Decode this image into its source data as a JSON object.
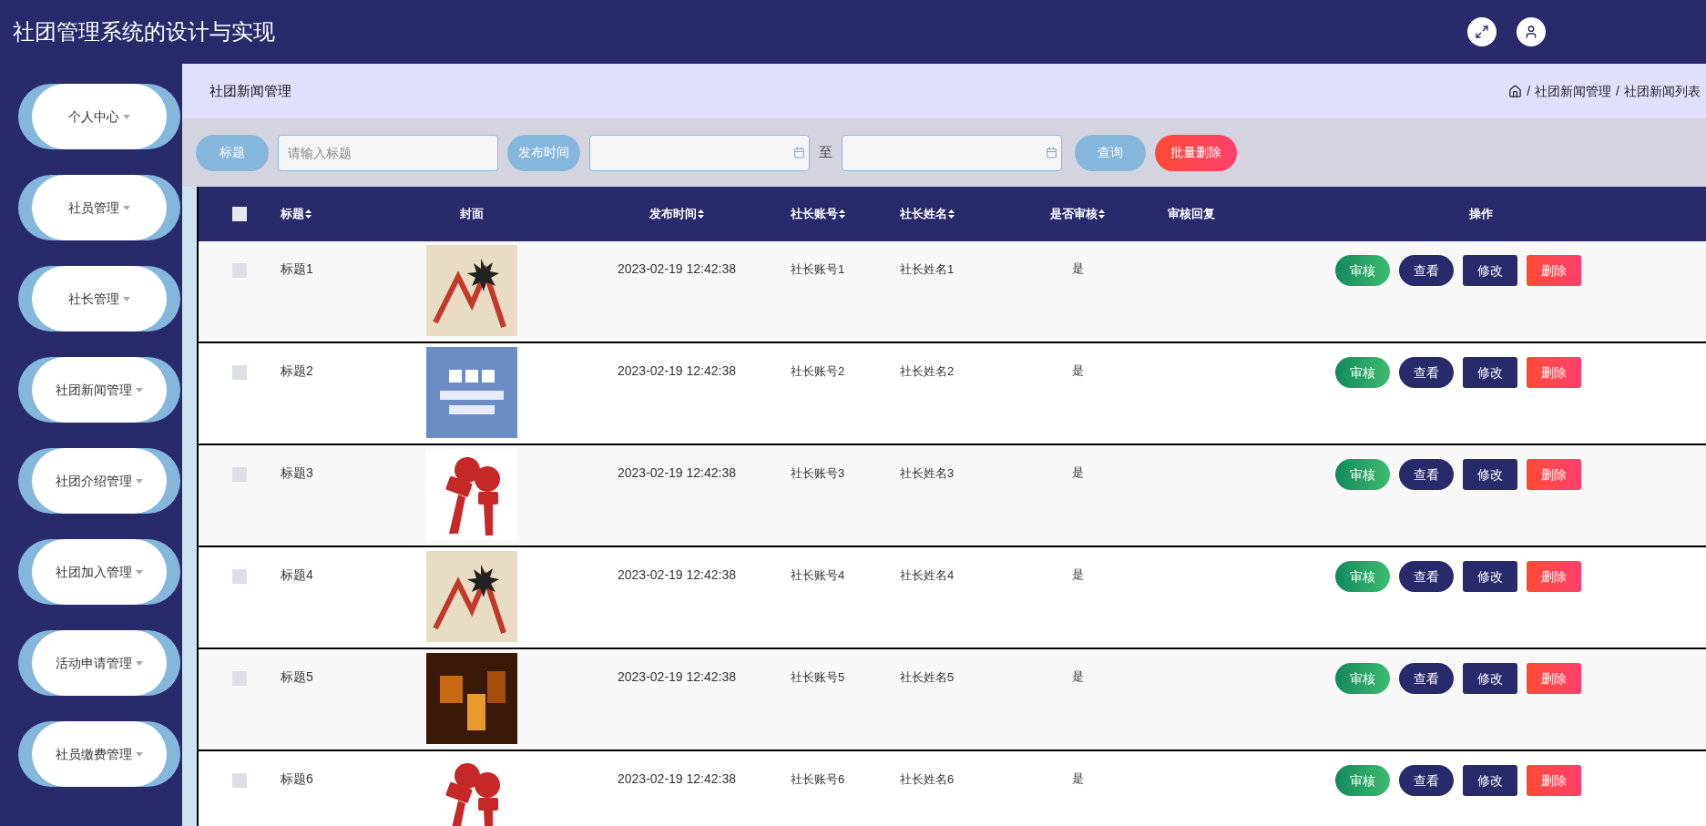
{
  "header": {
    "title": "社团管理系统的设计与实现"
  },
  "sidebar": {
    "items": [
      {
        "label": "个人中心"
      },
      {
        "label": "社员管理"
      },
      {
        "label": "社长管理"
      },
      {
        "label": "社团新闻管理"
      },
      {
        "label": "社团介绍管理"
      },
      {
        "label": "社团加入管理"
      },
      {
        "label": "活动申请管理"
      },
      {
        "label": "社员缴费管理"
      }
    ]
  },
  "page_title": "社团新闻管理",
  "breadcrumb": {
    "separator": "/",
    "items": [
      "社团新闻管理",
      "社团新闻列表"
    ]
  },
  "search": {
    "title_label": "标题",
    "title_field": {
      "placeholder": "请输入标题"
    },
    "date_label": "发布时间",
    "date_to": "至",
    "query_button": "查询",
    "batch_delete_button": "批量删除"
  },
  "table": {
    "select_all": {
      "checked": false
    },
    "columns": [
      {
        "label": "标题",
        "sortable": true
      },
      {
        "label": "封面",
        "sortable": false
      },
      {
        "label": "发布时间",
        "sortable": true
      },
      {
        "label": "社长账号",
        "sortable": true
      },
      {
        "label": "社长姓名",
        "sortable": true
      },
      {
        "label": "是否审核",
        "sortable": true
      },
      {
        "label": "审核回复",
        "sortable": false
      },
      {
        "label": "操作",
        "sortable": false
      }
    ],
    "rows": [
      {
        "checked": false,
        "title": "标题1",
        "cover": {
          "kind": "chart"
        },
        "time": "2023-02-19 12:42:38",
        "account": "社长账号1",
        "name": "社长姓名1",
        "audited": "是",
        "actions": [
          {
            "kind": "review",
            "label": "审核"
          },
          {
            "kind": "view",
            "label": "查看"
          },
          {
            "kind": "edit",
            "label": "修改"
          },
          {
            "kind": "delete",
            "label": "删除"
          }
        ]
      },
      {
        "checked": false,
        "title": "标题2",
        "cover": {
          "kind": "news"
        },
        "time": "2023-02-19 12:42:38",
        "account": "社长账号2",
        "name": "社长姓名2",
        "audited": "是",
        "actions": [
          {
            "kind": "review",
            "label": "审核"
          },
          {
            "kind": "view",
            "label": "查看"
          },
          {
            "kind": "edit",
            "label": "修改"
          },
          {
            "kind": "delete",
            "label": "删除"
          }
        ]
      },
      {
        "checked": false,
        "title": "标题3",
        "cover": {
          "kind": "microphone"
        },
        "time": "2023-02-19 12:42:38",
        "account": "社长账号3",
        "name": "社长姓名3",
        "audited": "是",
        "actions": [
          {
            "kind": "review",
            "label": "审核"
          },
          {
            "kind": "view",
            "label": "查看"
          },
          {
            "kind": "edit",
            "label": "修改"
          },
          {
            "kind": "delete",
            "label": "删除"
          }
        ]
      },
      {
        "checked": false,
        "title": "标题4",
        "cover": {
          "kind": "chart"
        },
        "time": "2023-02-19 12:42:38",
        "account": "社长账号4",
        "name": "社长姓名4",
        "audited": "是",
        "actions": [
          {
            "kind": "review",
            "label": "审核"
          },
          {
            "kind": "view",
            "label": "查看"
          },
          {
            "kind": "edit",
            "label": "修改"
          },
          {
            "kind": "delete",
            "label": "删除"
          }
        ]
      },
      {
        "checked": false,
        "title": "标题5",
        "cover": {
          "kind": "money"
        },
        "time": "2023-02-19 12:42:38",
        "account": "社长账号5",
        "name": "社长姓名5",
        "audited": "是",
        "actions": [
          {
            "kind": "review",
            "label": "审核"
          },
          {
            "kind": "view",
            "label": "查看"
          },
          {
            "kind": "edit",
            "label": "修改"
          },
          {
            "kind": "delete",
            "label": "删除"
          }
        ]
      },
      {
        "checked": false,
        "title": "标题6",
        "cover": {
          "kind": "microphone"
        },
        "time": "2023-02-19 12:42:38",
        "account": "社长账号6",
        "name": "社长姓名6",
        "audited": "是",
        "actions": [
          {
            "kind": "review",
            "label": "审核"
          },
          {
            "kind": "view",
            "label": "查看"
          },
          {
            "kind": "edit",
            "label": "修改"
          },
          {
            "kind": "delete",
            "label": "删除"
          }
        ]
      }
    ]
  }
}
